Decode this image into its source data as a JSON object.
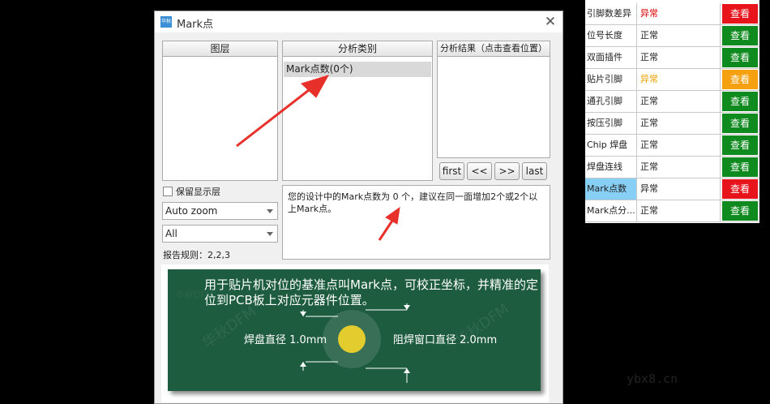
{
  "dialog": {
    "title": "Mark点",
    "icon_text": "华秋",
    "close_glyph": "✕"
  },
  "panels": {
    "layers_header": "图层",
    "category_header": "分析类别",
    "category_items": [
      "Mark点数(0个)"
    ],
    "results_header": "分析结果（点击查看位置）"
  },
  "nav_buttons": [
    "first",
    "<<",
    ">>",
    "last"
  ],
  "keep_layer_label": "保留显示层",
  "zoom_select": {
    "value": "Auto zoom"
  },
  "layer_select": {
    "value": "All"
  },
  "report_rule": "报告规则：2,2,3",
  "message": "您的设计中的Mark点数为 0 个，建议在同一面增加2个或2个以上Mark点。",
  "illustration": {
    "caption_line1": "用于贴片机对位的基准点叫Mark点，可校正坐标，并精准的定",
    "caption_line2": "位到PCB板上对应元器件位置。",
    "pad_label": "焊盘直径 1.0mm",
    "window_label": "阻焊窗口直径 2.0mm",
    "watermark": "华秋DFM",
    "bg_color": "#1e5c40",
    "pad_color": "#e3cc2e"
  },
  "right_table": {
    "rows": [
      {
        "name": "引脚数差异",
        "status": "异常",
        "status_color": "#e00000",
        "button": "查看",
        "button_color": "#e8141c"
      },
      {
        "name": "位号长度",
        "status": "正常",
        "status_color": "#222222",
        "button": "查看",
        "button_color": "#0f8a1e"
      },
      {
        "name": "双面插件",
        "status": "正常",
        "status_color": "#222222",
        "button": "查看",
        "button_color": "#0f8a1e"
      },
      {
        "name": "贴片引脚",
        "status": "异常",
        "status_color": "#f0a000",
        "button": "查看",
        "button_color": "#f5a00f"
      },
      {
        "name": "通孔引脚",
        "status": "正常",
        "status_color": "#222222",
        "button": "查看",
        "button_color": "#0f8a1e"
      },
      {
        "name": "按压引脚",
        "status": "正常",
        "status_color": "#222222",
        "button": "查看",
        "button_color": "#0f8a1e"
      },
      {
        "name": "Chip 焊盘",
        "status": "正常",
        "status_color": "#222222",
        "button": "查看",
        "button_color": "#0f8a1e"
      },
      {
        "name": "焊盘连线",
        "status": "正常",
        "status_color": "#222222",
        "button": "查看",
        "button_color": "#0f8a1e"
      },
      {
        "name": "Mark点数",
        "status": "异常",
        "status_color": "#222222",
        "button": "查看",
        "button_color": "#e8141c",
        "highlight": "#87cff5"
      },
      {
        "name": "Mark点分...",
        "status": "正常",
        "status_color": "#222222",
        "button": "查看",
        "button_color": "#0f8a1e"
      }
    ]
  },
  "watermark_site": "ybx8.cn",
  "annotation_color": "#e8302a"
}
